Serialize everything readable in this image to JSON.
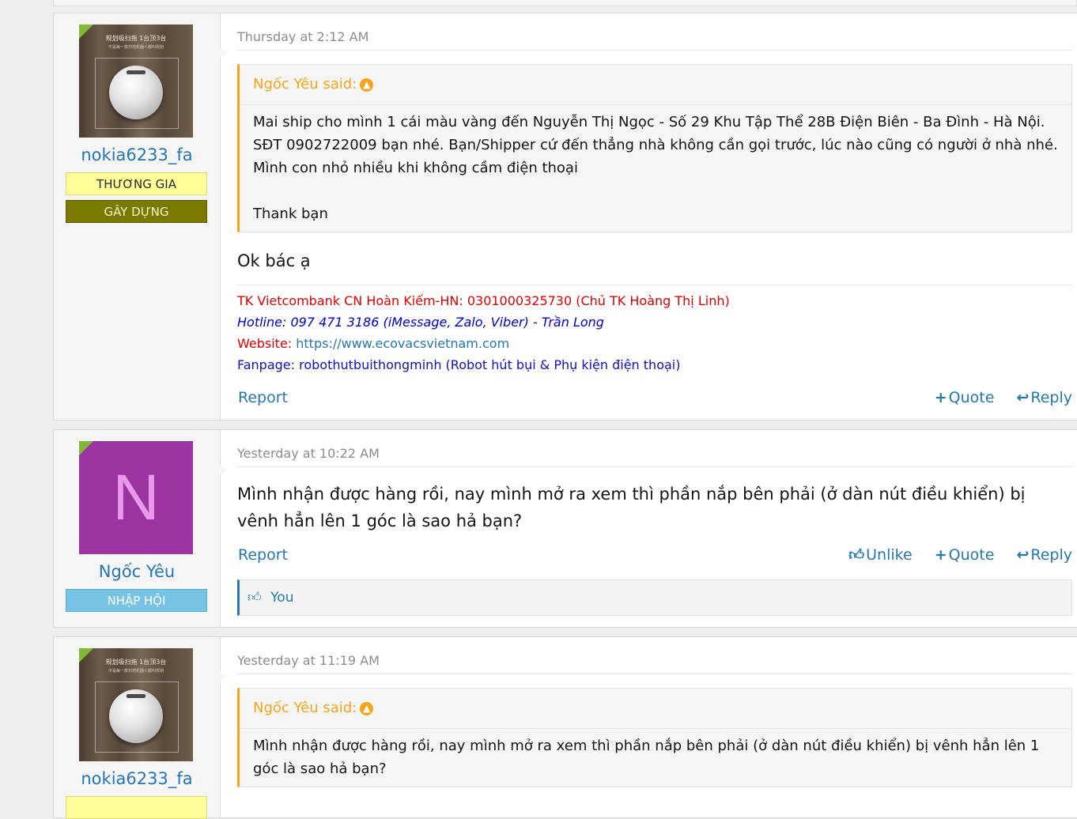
{
  "posts": [
    {
      "author": "nokia6233_fa",
      "avatar": {
        "type": "image",
        "caption_line1": "规划吸扫拖 1台顶3台",
        "caption_line2": "不是每一款扫地机器人都叫规划"
      },
      "banners": [
        "THƯƠNG GIA",
        "GÂY DỰNG"
      ],
      "timestamp": "Thursday at 2:12 AM",
      "quote": {
        "author_said": "Ngốc Yêu said:",
        "up_icon": "arrow-up-circle-icon",
        "lines": [
          "Mai ship cho mình 1 cái màu vàng đến Nguyễn Thị Ngọc - Số 29 Khu Tập Thể 28B Điện Biên - Ba Đình - Hà Nội. SĐT 0902722009 bạn nhé. Bạn/Shipper cứ đến thẳng nhà không cần gọi trước, lúc nào cũng có người ở nhà nhé. Mình con nhỏ nhiều khi không cầm điện thoại",
          "Thank bạn"
        ]
      },
      "message": "Ok bác ạ",
      "signature": {
        "bank": "TK Vietcombank CN Hoàn Kiếm-HN: 0301000325730 (Chủ TK Hoàng Thị Linh)",
        "hotline": "Hotline: 097 471 3186 (iMessage, Zalo, Viber) - Trần Long",
        "website_label": "Website:",
        "website_url": "https://www.ecovacsvietnam.com",
        "fanpage": "Fanpage: robothutbuithongminh (Robot hút bụi & Phụ kiện điện thoại)"
      },
      "report": "Report",
      "quote_label": "Quote",
      "reply_label": "Reply"
    },
    {
      "author": "Ngốc Yêu",
      "avatar": {
        "type": "letter",
        "letter": "N"
      },
      "banners": [
        "NHẬP HỘI"
      ],
      "timestamp": "Yesterday at 10:22 AM",
      "message": "Mình nhận được hàng rồi, nay mình mở ra xem thì phần nắp bên phải (ở dàn nút điều khiển) bị vênh hẳn lên 1 góc là sao hả bạn?",
      "report": "Report",
      "unlike_label": "Unlike",
      "quote_label": "Quote",
      "reply_label": "Reply",
      "likes": "You"
    },
    {
      "author": "nokia6233_fa",
      "avatar": {
        "type": "image",
        "caption_line1": "规划吸扫拖 1台顶3台",
        "caption_line2": "不是每一款扫地机器人都叫规划"
      },
      "timestamp": "Yesterday at 11:19 AM",
      "quote": {
        "author_said": "Ngốc Yêu said:",
        "up_icon": "arrow-up-circle-icon",
        "lines": [
          "Mình nhận được hàng rồi, nay mình mở ra xem thì phần nắp bên phải (ở dàn nút điều khiển) bị vênh hẳn lên 1 góc là sao hả bạn?"
        ]
      }
    }
  ],
  "colors": {
    "link": "#2577b1",
    "quote_accent": "#f6a51b",
    "online": "#7fb935",
    "letter_avatar_bg": "#9b34a0"
  }
}
